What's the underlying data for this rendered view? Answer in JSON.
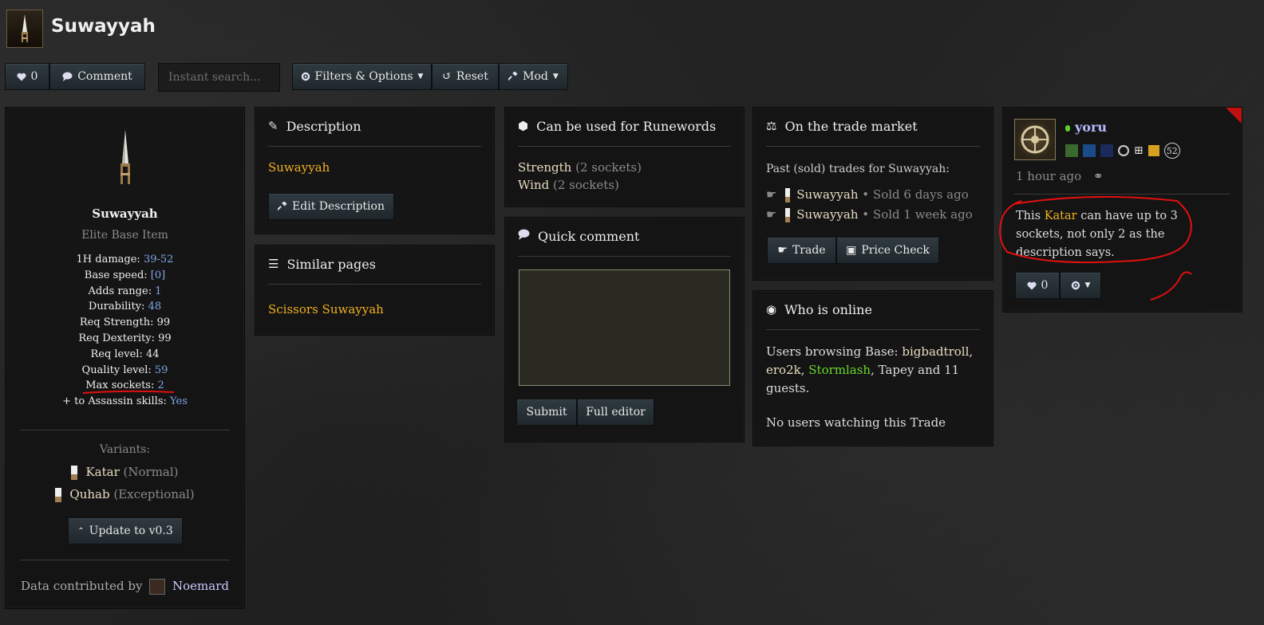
{
  "page": {
    "title": "Suwayyah"
  },
  "toolbar": {
    "like_count": "0",
    "comment_label": "Comment",
    "search_placeholder": "Instant search...",
    "filters_label": "Filters & Options",
    "reset_label": "Reset",
    "mod_label": "Mod"
  },
  "item": {
    "name": "Suwayyah",
    "type": "Elite Base Item",
    "stats": [
      {
        "label": "1H damage:",
        "value": "39-52"
      },
      {
        "label": "Base speed:",
        "value": "[0]"
      },
      {
        "label": "Adds range:",
        "value": "1"
      },
      {
        "label": "Durability:",
        "value": "48"
      },
      {
        "label": "Req Strength:",
        "value": "99"
      },
      {
        "label": "Req Dexterity:",
        "value": "99"
      },
      {
        "label": "Req level:",
        "value": "44"
      },
      {
        "label": "Quality level:",
        "value": "59"
      },
      {
        "label": "Max sockets:",
        "value": "2"
      },
      {
        "label": "+ to Assassin skills:",
        "value": "Yes"
      }
    ],
    "variants_label": "Variants:",
    "variants": [
      {
        "name": "Katar",
        "tier": "(Normal)"
      },
      {
        "name": "Quhab",
        "tier": "(Exceptional)"
      }
    ],
    "update_label": "Update to v0.3",
    "contributed_label": "Data contributed by",
    "contributor": "Noemard"
  },
  "description": {
    "title": "Description",
    "text": "Suwayyah",
    "edit_label": "Edit Description"
  },
  "similar": {
    "title": "Similar pages",
    "link": "Scissors Suwayyah"
  },
  "runewords": {
    "title": "Can be used for Runewords",
    "items": [
      {
        "name": "Strength",
        "sockets": "(2 sockets)"
      },
      {
        "name": "Wind",
        "sockets": "(2 sockets)"
      }
    ]
  },
  "quick_comment": {
    "title": "Quick comment",
    "submit_label": "Submit",
    "full_editor_label": "Full editor"
  },
  "trade": {
    "title": "On the trade market",
    "subtitle": "Past (sold) trades for Suwayyah:",
    "trades": [
      {
        "name": "Suwayyah",
        "status": "• Sold 6 days ago"
      },
      {
        "name": "Suwayyah",
        "status": "• Sold 1 week ago"
      }
    ],
    "trade_label": "Trade",
    "price_check_label": "Price Check"
  },
  "online": {
    "title": "Who is online",
    "browsing_prefix": "Users browsing Base:",
    "users": [
      "bigbadtroll,",
      "ero2k,",
      "Stormlash",
      ", Tapey and 11 guests."
    ],
    "watching": "No users watching this Trade"
  },
  "comment": {
    "username": "yoru",
    "badge_count": "52",
    "time": "1 hour ago",
    "text_before": "This",
    "highlight": "Katar",
    "text_after": "can have up to 3 sockets, not only 2 as the description says.",
    "like_count": "0"
  },
  "colors": {
    "gold": "#f0b020",
    "blue": "#7fa6e8",
    "green": "#6bd92b",
    "annotation_red": "#e01010"
  }
}
